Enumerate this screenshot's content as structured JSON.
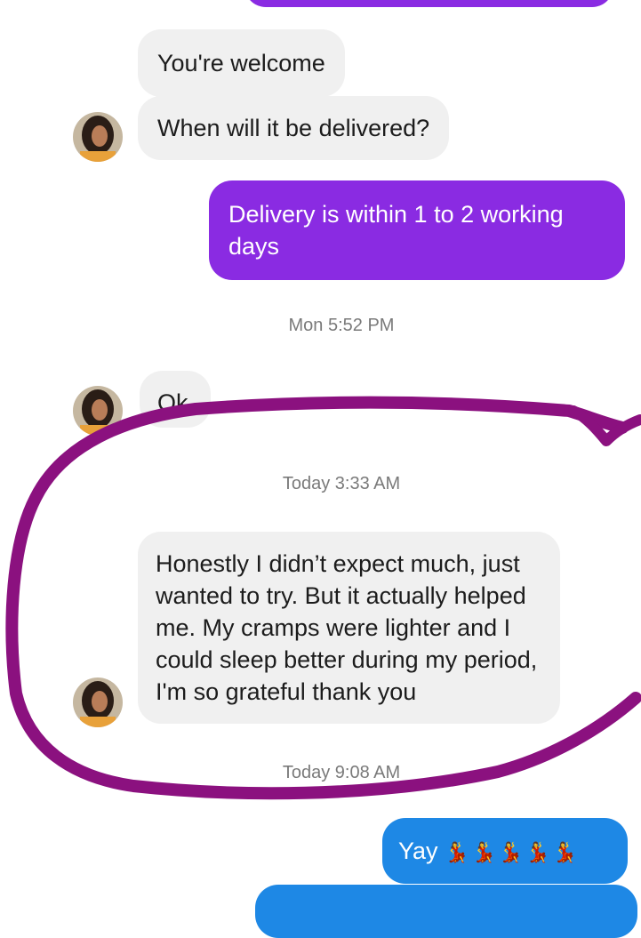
{
  "colors": {
    "incoming_bubble": "#f0f0f0",
    "outgoing_purple": "#8a2be2",
    "outgoing_blue": "#1e88e5",
    "annotation_stroke": "#8b117f"
  },
  "messages": [
    {
      "sender": "them",
      "text": "You're welcome"
    },
    {
      "sender": "them",
      "text": "When will it be delivered?"
    },
    {
      "sender": "me",
      "text": "Delivery is within 1 to 2 working days"
    },
    {
      "sender": "them",
      "text": "Ok"
    },
    {
      "sender": "them",
      "text": "Honestly I didn’t expect much, just wanted to try. But it actually helped me. My cramps were lighter and I could sleep better during my period, I'm so grateful thank you"
    },
    {
      "sender": "me",
      "text": "Yay",
      "emoji": "💃💃💃💃💃"
    }
  ],
  "timestamps": [
    "Mon 5:52 PM",
    "Today 3:33 AM",
    "Today 9:08 AM"
  ],
  "avatar_icon": "profile-photo-icon",
  "annotation": "hand-drawn-circle"
}
